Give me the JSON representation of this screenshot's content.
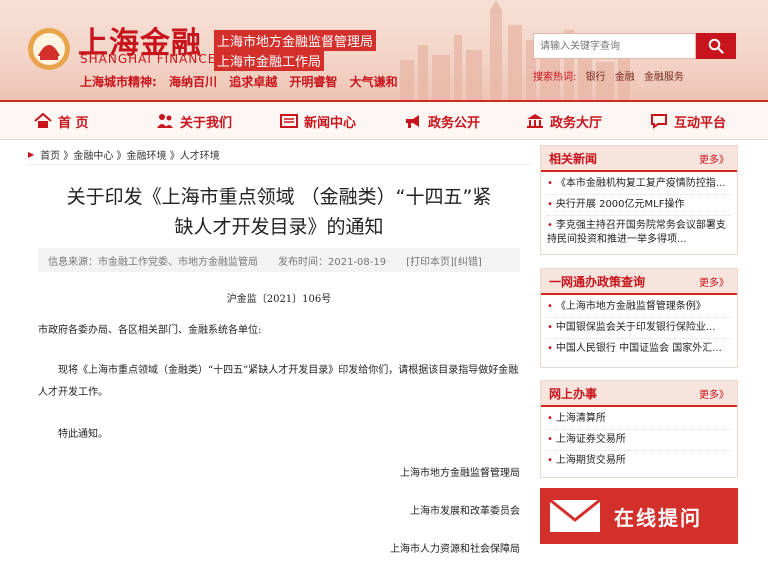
{
  "header": {
    "brand_cn": "上海金融",
    "brand_en": "SHANGHAI FINANCE",
    "org_line1": "上海市地方金融监督管理局",
    "org_line2": "上海市金融工作局",
    "spirit_label": "上海城市精神:",
    "spirit_items": [
      "海纳百川",
      "追求卓越",
      "开明睿智",
      "大气谦和"
    ],
    "search_placeholder": "请输入关键字查询",
    "search_words_label": "搜索热词:",
    "search_words": [
      "银行",
      "金融",
      "金融服务"
    ]
  },
  "nav": {
    "items": [
      "首 页",
      "关于我们",
      "新闻中心",
      "政务公开",
      "政务大厅",
      "互动平台"
    ]
  },
  "breadcrumb": "首页 》金融中心 》金融环境 》人才环境",
  "article": {
    "title_line1": "关于印发《上海市重点领域 （金融类）“十四五”紧",
    "title_line2": "缺人才开发目录》的通知",
    "source": "信息来源：市金融工作党委、市地方金融监管局",
    "date": "发布时间：2021-08-19",
    "actions": "[打印本页][纠错]",
    "doc_no": "沪金监〔2021〕106号",
    "para1": "市政府各委办局、各区相关部门、金融系统各单位:",
    "para2": "现将《上海市重点领域（金融类）“十四五”紧缺人才开发目录》印发给你们，请根据该目录指导做好金融人才开发工作。",
    "para3": "特此通知。",
    "sign1": "上海市地方金融监督管理局",
    "sign2": "上海市发展和改革委员会",
    "sign3": "上海市人力资源和社会保障局"
  },
  "sidebar": {
    "related": {
      "title": "相关新闻",
      "more": "更多》",
      "items": [
        "《本市金融机构复工复产疫情防控指...",
        "央行开展 2000亿元MLF操作",
        "李克强主持召开国务院常务会议部署支持民间投资和推进一举多得项..."
      ]
    },
    "policy": {
      "title": "一网通办政策查询",
      "more": "更多》",
      "items": [
        "《上海市地方金融监督管理条例》",
        "中国银保监会关于印发银行保险业...",
        "中国人民银行 中国证监会 国家外汇..."
      ]
    },
    "online_service": {
      "title": "网上办事",
      "more": "更多》",
      "items": [
        "上海清算所",
        "上海证券交易所",
        "上海期货交易所"
      ]
    },
    "online_ask": "在线提问"
  },
  "colors": {
    "accent": "#c8141c",
    "accent_bg": "#d3302c"
  }
}
